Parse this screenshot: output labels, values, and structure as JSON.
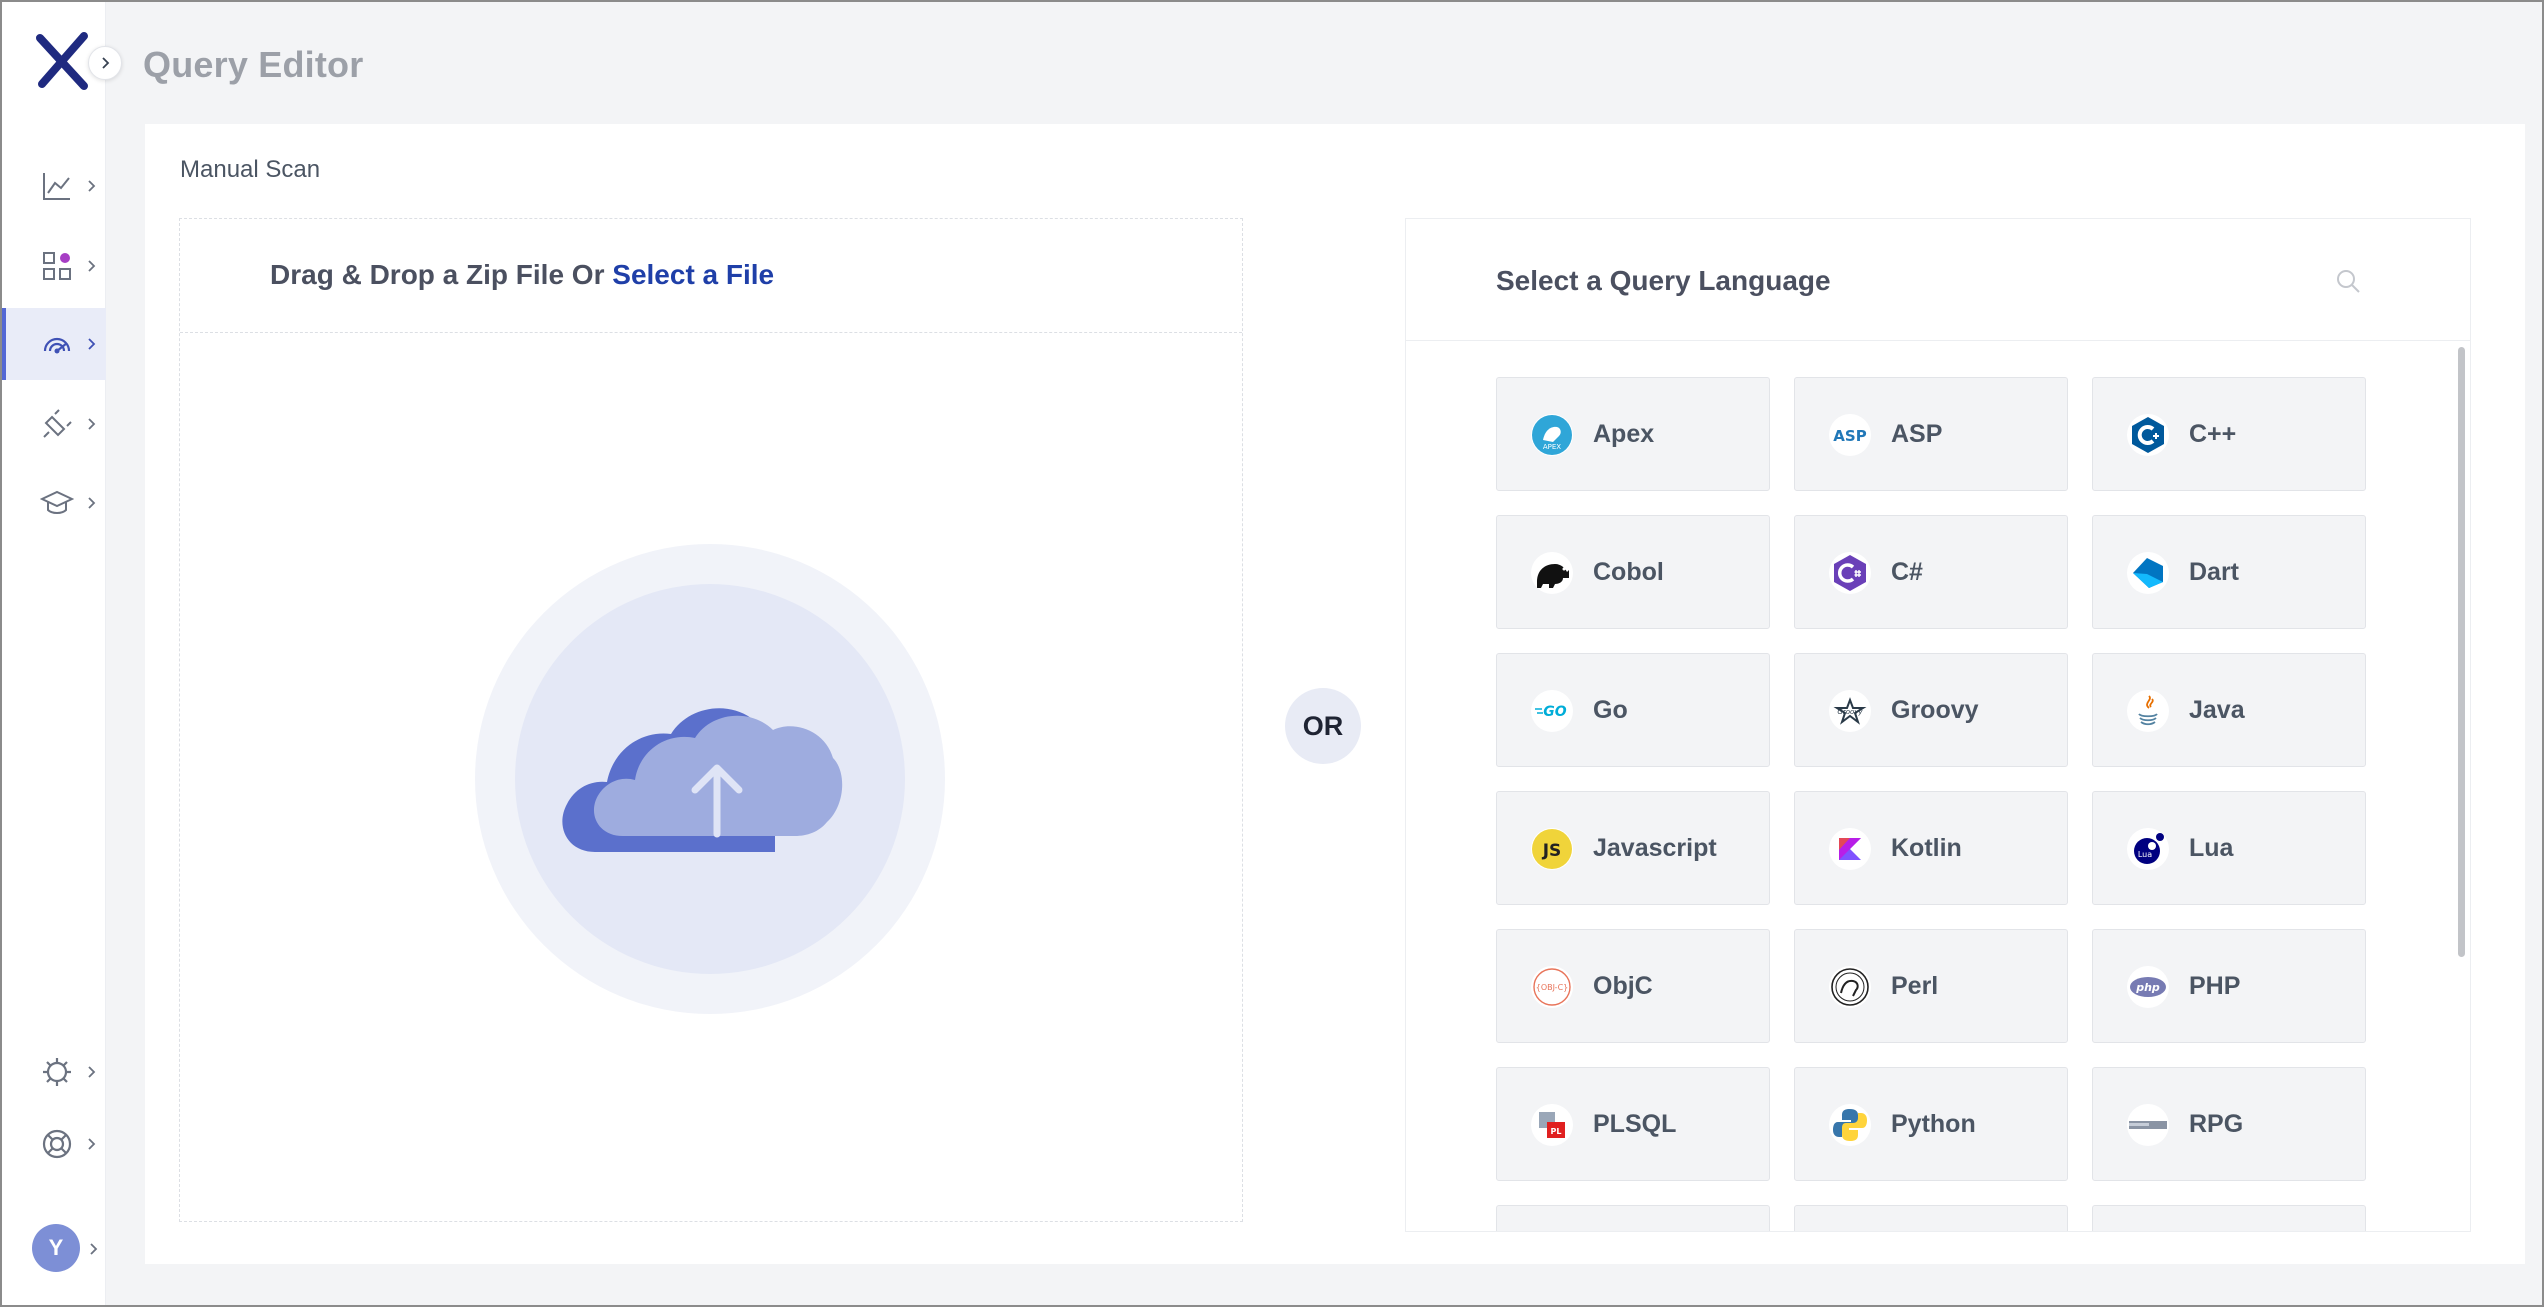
{
  "header": {
    "title": "Query Editor"
  },
  "sidebar": {
    "items": [
      {
        "name": "analytics",
        "icon": "chart-line-icon"
      },
      {
        "name": "apps",
        "icon": "apps-grid-icon",
        "badge_color": "#a63ec4"
      },
      {
        "name": "scan",
        "icon": "scan-radar-icon",
        "active": true
      },
      {
        "name": "plugins",
        "icon": "plug-icon"
      },
      {
        "name": "training",
        "icon": "graduation-cap-icon"
      },
      {
        "name": "settings",
        "icon": "gear-icon"
      },
      {
        "name": "support",
        "icon": "lifebuoy-icon"
      }
    ],
    "avatar_initial": "Y"
  },
  "main": {
    "section_label": "Manual Scan",
    "upload": {
      "text": "Drag & Drop a Zip File Or ",
      "link_text": "Select a File"
    },
    "or_label": "OR",
    "languages": {
      "title": "Select a Query Language",
      "items": [
        {
          "label": "Apex",
          "icon": "apex-icon"
        },
        {
          "label": "ASP",
          "icon": "asp-icon"
        },
        {
          "label": "C++",
          "icon": "cpp-icon"
        },
        {
          "label": "Cobol",
          "icon": "cobol-icon"
        },
        {
          "label": "C#",
          "icon": "csharp-icon"
        },
        {
          "label": "Dart",
          "icon": "dart-icon"
        },
        {
          "label": "Go",
          "icon": "go-icon"
        },
        {
          "label": "Groovy",
          "icon": "groovy-icon"
        },
        {
          "label": "Java",
          "icon": "java-icon"
        },
        {
          "label": "Javascript",
          "icon": "javascript-icon"
        },
        {
          "label": "Kotlin",
          "icon": "kotlin-icon"
        },
        {
          "label": "Lua",
          "icon": "lua-icon"
        },
        {
          "label": "ObjC",
          "icon": "objc-icon"
        },
        {
          "label": "Perl",
          "icon": "perl-icon"
        },
        {
          "label": "PHP",
          "icon": "php-icon"
        },
        {
          "label": "PLSQL",
          "icon": "plsql-icon"
        },
        {
          "label": "Python",
          "icon": "python-icon"
        },
        {
          "label": "RPG",
          "icon": "rpg-icon"
        }
      ]
    }
  },
  "colors": {
    "brand_navy": "#1f2a80",
    "accent": "#5468d4",
    "link": "#1f3fa8",
    "cloud_dark": "#5b70cc",
    "cloud_light": "#9eacdf"
  }
}
